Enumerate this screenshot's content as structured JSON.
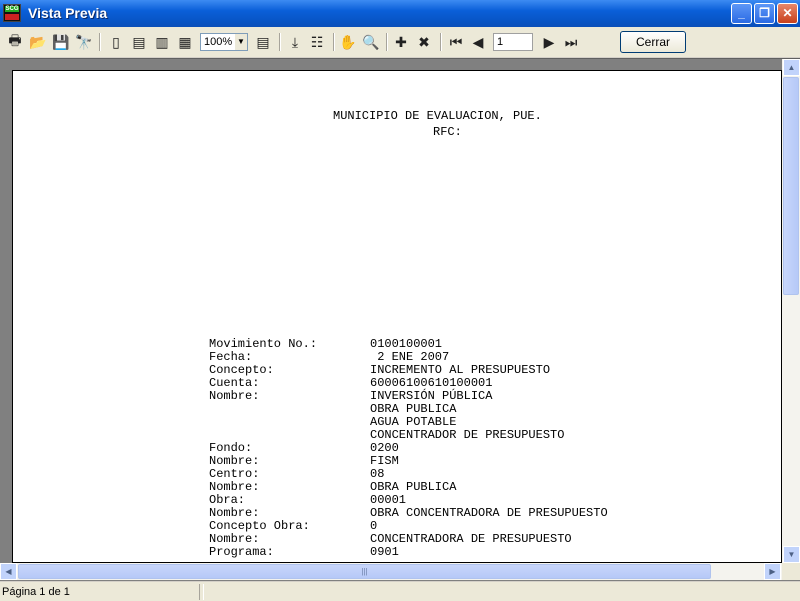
{
  "window": {
    "title": "Vista Previa",
    "icon_label": "SCG"
  },
  "toolbar": {
    "zoom_value": "100%",
    "page_input": "1",
    "close_label": "Cerrar",
    "icons": [
      "print-icon",
      "open-icon",
      "save-icon",
      "find-icon",
      "one-page-icon",
      "page-width-icon",
      "two-pages-icon",
      "four-pages-icon",
      "zoom-dropdown",
      "outline-icon",
      "expand-icon",
      "tree-icon",
      "hand-icon",
      "zoom-in-icon",
      "add-page-icon",
      "delete-page-icon",
      "first-page-icon",
      "prev-page-icon",
      "next-page-icon",
      "last-page-icon"
    ]
  },
  "report": {
    "header": "MUNICIPIO DE EVALUACION, PUE.",
    "rfc": "RFC:",
    "labels": "Movimiento No.:\nFecha:\nConcepto:\nCuenta:\nNombre:\n\n\n\nFondo:\nNombre:\nCentro:\nNombre:\nObra:\nNombre:\nConcepto Obra:\nNombre:\nPrograma:",
    "values": "0100100001\n 2 ENE 2007\nINCREMENTO AL PRESUPUESTO\n60006100610100001\nINVERSIÓN PÚBLICA\nOBRA PUBLICA\nAGUA POTABLE\nCONCENTRADOR DE PRESUPUESTO\n0200\nFISM\n08\nOBRA PUBLICA\n00001\nOBRA CONCENTRADORA DE PRESUPUESTO\n0\nCONCENTRADORA DE PRESUPUESTO\n0901"
  },
  "status": {
    "page_info": "Página 1 de 1"
  }
}
